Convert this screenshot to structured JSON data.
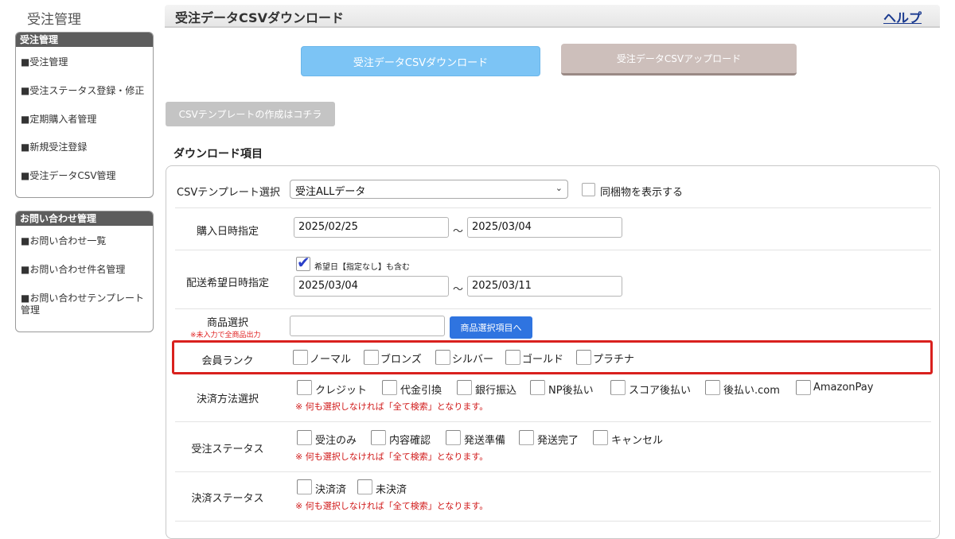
{
  "sidebar": {
    "title": "受注管理",
    "group1": {
      "header": "受注管理",
      "items": [
        "■受注管理",
        "■受注ステータス登録・修正",
        "■定期購入者管理",
        "■新規受注登録",
        "■受注データCSV管理"
      ]
    },
    "group2": {
      "header": "お問い合わせ管理",
      "items": [
        "■お問い合わせ一覧",
        "■お問い合わせ件名管理",
        "■お問い合わせテンプレート管理"
      ]
    }
  },
  "header": {
    "title": "受注データCSVダウンロード",
    "help": "ヘルプ"
  },
  "buttons": {
    "download": "受注データCSVダウンロード",
    "upload": "受注データCSVアップロード",
    "template": "CSVテンプレートの作成はコチラ",
    "product_select": "商品選択項目へ"
  },
  "section_title": "ダウンロード項目",
  "form": {
    "template_select": {
      "label": "CSVテンプレート選択",
      "value": "受注ALLデータ",
      "bundle_label": "同梱物を表示する",
      "bundle_checked": false
    },
    "purchase_date": {
      "label": "購入日時指定",
      "from": "2025/02/25",
      "tilde": "～",
      "to": "2025/03/04"
    },
    "delivery_date": {
      "label": "配送希望日時指定",
      "include_label": "希望日【指定なし】も含む",
      "include_checked": true,
      "from": "2025/03/04",
      "tilde": "～",
      "to": "2025/03/11"
    },
    "product": {
      "label": "商品選択",
      "note": "※未入力で全商品出力",
      "value": ""
    },
    "member_rank": {
      "label": "会員ランク",
      "options": [
        "ノーマル",
        "ブロンズ",
        "シルバー",
        "ゴールド",
        "プラチナ"
      ]
    },
    "payment_method": {
      "label": "決済方法選択",
      "options": [
        "クレジット",
        "代金引換",
        "銀行振込",
        "NP後払い",
        "スコア後払い",
        "後払い.com",
        "AmazonPay"
      ],
      "note": "※ 何も選択しなければ「全て検索」となります。"
    },
    "order_status": {
      "label": "受注ステータス",
      "options": [
        "受注のみ",
        "内容確認",
        "発送準備",
        "発送完了",
        "キャンセル"
      ],
      "note": "※ 何も選択しなければ「全て検索」となります。"
    },
    "payment_status": {
      "label": "決済ステータス",
      "options": [
        "決済済",
        "未決済"
      ],
      "note": "※ 何も選択しなければ「全て検索」となります。"
    }
  },
  "colors": {
    "download_button": "#7cc4f5",
    "upload_button": "#cdbfbb",
    "product_button": "#2f74e0",
    "highlight_border": "#d9211e",
    "note_text": "#d01818"
  }
}
